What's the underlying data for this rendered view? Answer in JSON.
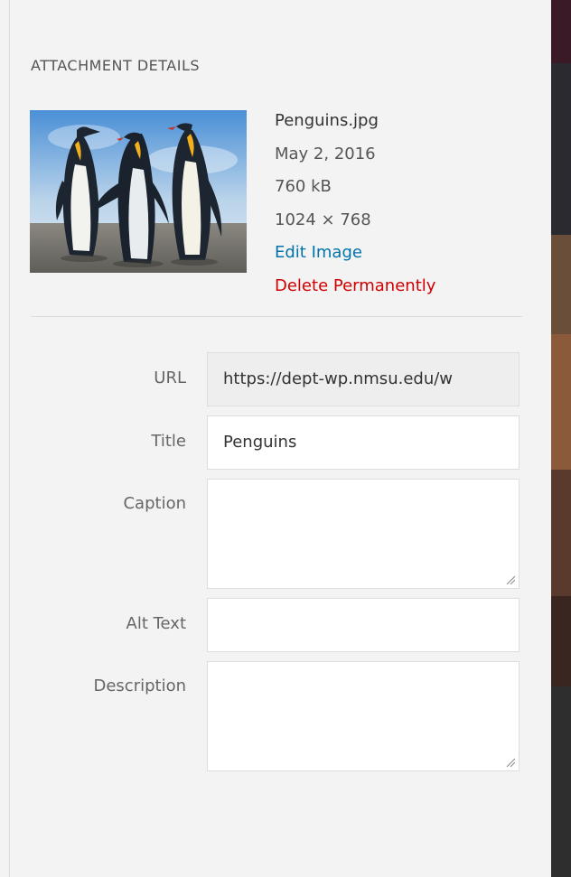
{
  "panel": {
    "heading": "ATTACHMENT DETAILS"
  },
  "attachment": {
    "filename": "Penguins.jpg",
    "date": "May 2, 2016",
    "size": "760 kB",
    "dimensions": "1024 × 768",
    "edit_label": "Edit Image",
    "delete_label": "Delete Permanently"
  },
  "fields": {
    "url": {
      "label": "URL",
      "value": "https://dept-wp.nmsu.edu/w"
    },
    "title": {
      "label": "Title",
      "value": "Penguins"
    },
    "caption": {
      "label": "Caption",
      "value": ""
    },
    "alt": {
      "label": "Alt Text",
      "value": ""
    },
    "description": {
      "label": "Description",
      "value": ""
    }
  },
  "colors": {
    "link": "#0073aa",
    "delete": "#d00000",
    "panel_bg": "#f3f3f3",
    "readonly_bg": "#eeeeee"
  }
}
